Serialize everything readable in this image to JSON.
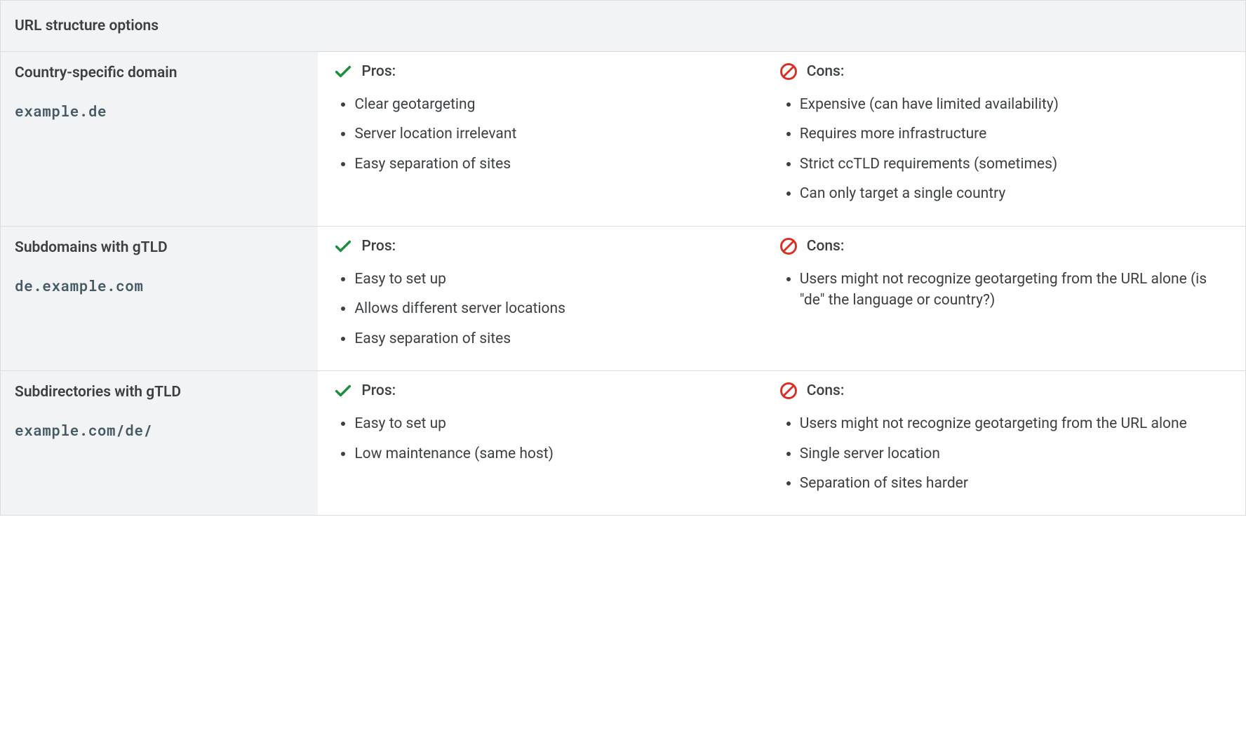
{
  "header": "URL structure options",
  "pros_label": "Pros:",
  "cons_label": "Cons:",
  "rows": [
    {
      "title": "Country-specific domain",
      "example": "example.de",
      "pros": [
        "Clear geotargeting",
        "Server location irrelevant",
        "Easy separation of sites"
      ],
      "cons": [
        "Expensive (can have limited availability)",
        "Requires more infrastructure",
        "Strict ccTLD requirements (sometimes)",
        "Can only target a single country"
      ]
    },
    {
      "title": "Subdomains with gTLD",
      "example": "de.example.com",
      "pros": [
        "Easy to set up",
        "Allows different server locations",
        "Easy separation of sites"
      ],
      "cons": [
        "Users might not recognize geotargeting from the URL alone (is \"de\" the language or country?)"
      ]
    },
    {
      "title": "Subdirectories with gTLD",
      "example": "example.com/de/",
      "pros": [
        "Easy to set up",
        "Low maintenance (same host)"
      ],
      "cons": [
        "Users might not recognize geotargeting from the URL alone",
        "Single server location",
        "Separation of sites harder"
      ]
    }
  ]
}
